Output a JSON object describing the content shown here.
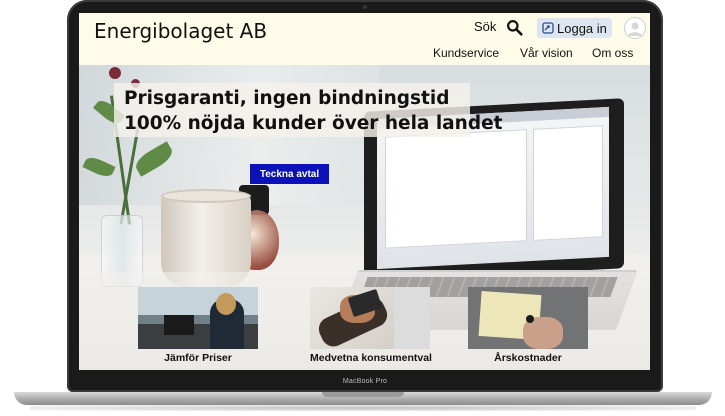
{
  "device": {
    "label": "MacBook Pro"
  },
  "header": {
    "logo": "Energibolaget AB",
    "search_label": "Sök",
    "login_label": "Logga in",
    "nav": [
      "Kundservice",
      "Vår vision",
      "Om oss"
    ]
  },
  "hero": {
    "headline_line1": "Prisgaranti, ingen bindningstid",
    "headline_line2": "100% nöjda kunder över hela landet",
    "cta_label": "Teckna avtal"
  },
  "cards": [
    {
      "label": "Jämför Priser"
    },
    {
      "label": "Medvetna konsumentval"
    },
    {
      "label": "Årskostnader"
    }
  ],
  "colors": {
    "header_bg": "#fffbe9",
    "cta_bg": "#0b12b8",
    "login_bg": "#dde6f0"
  }
}
